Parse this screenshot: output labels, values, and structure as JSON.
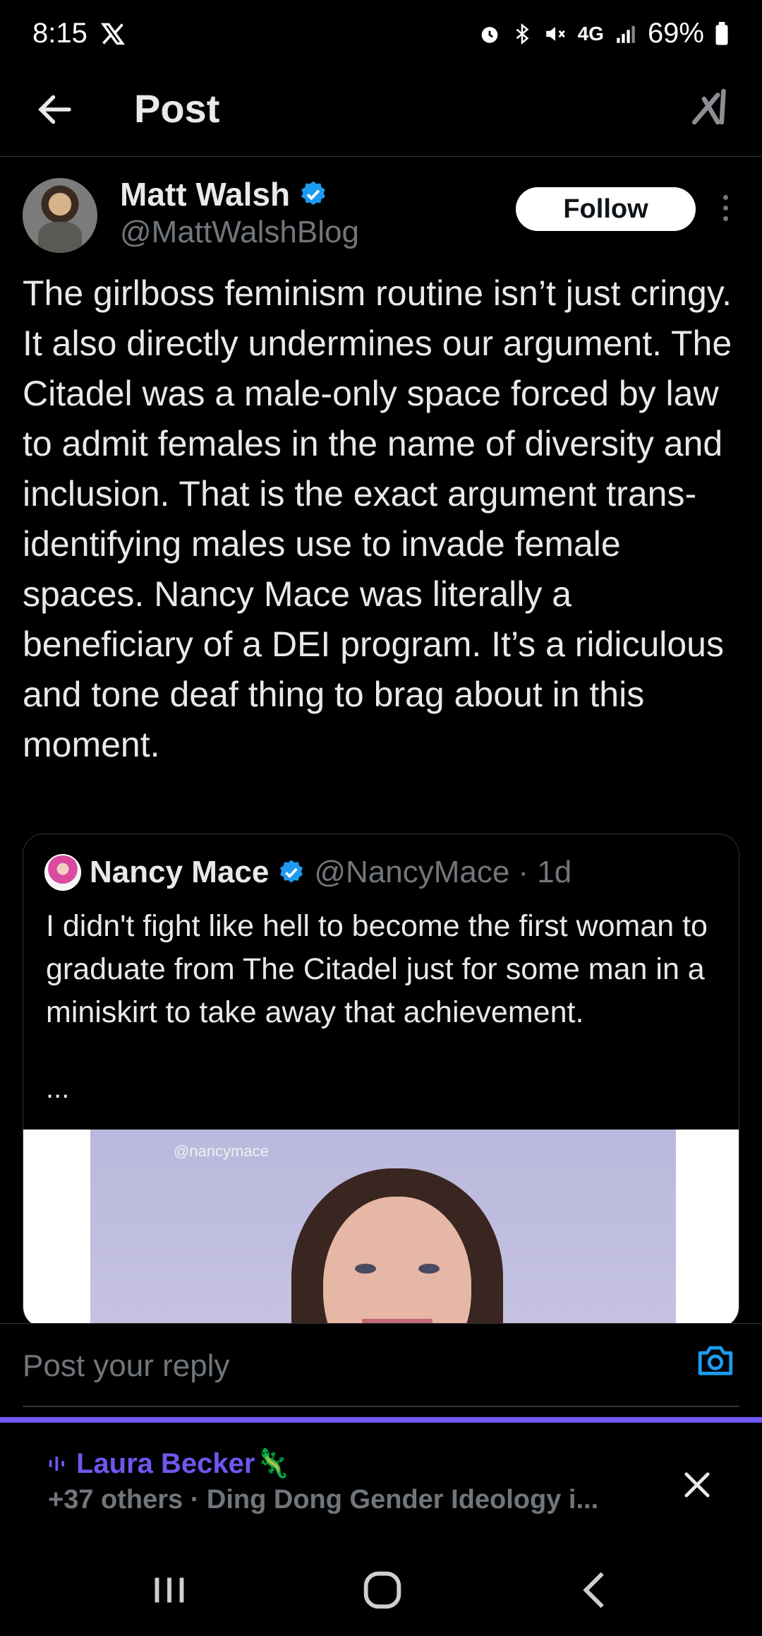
{
  "status_bar": {
    "time": "8:15",
    "x_app_icon": "x-logo-icon",
    "battery": "69%",
    "icons": [
      "alarm-icon",
      "bluetooth-icon",
      "mute-icon",
      "4g-icon",
      "signal-icon",
      "battery-icon"
    ],
    "network": "4G"
  },
  "header": {
    "title": "Post",
    "back_icon": "back-arrow-icon",
    "grok_icon": "grok-icon"
  },
  "post": {
    "author_name": "Matt Walsh",
    "author_handle": "@MattWalshBlog",
    "follow_label": "Follow",
    "text": "The girlboss feminism routine isn’t just cringy. It also directly undermines our argument. The Citadel was a male-only space forced by law to admit females in the name of diversity and inclusion. That is the exact argument trans-identifying males use to invade female spaces. Nancy Mace was literally a beneficiary of a DEI program. It’s a ridiculous and tone deaf thing to brag about in this moment."
  },
  "quote": {
    "author_name": "Nancy Mace",
    "author_handle": "@NancyMace",
    "time": "· 1d",
    "text": "I didn't fight like hell to become the first woman to graduate from The Citadel just for some man in a miniskirt to take away that achievement.",
    "ellipsis": "...",
    "image_watermark": "@nancymace"
  },
  "reply": {
    "placeholder": "Post your reply"
  },
  "space": {
    "host": "Laura Becker🦎",
    "subtitle": "+37 others · Ding Dong Gender Ideology i..."
  },
  "colors": {
    "background": "#000000",
    "text": "#e7e9ea",
    "muted": "#71767b",
    "verified": "#1d9bf0",
    "space_accent": "#6e58f0"
  }
}
